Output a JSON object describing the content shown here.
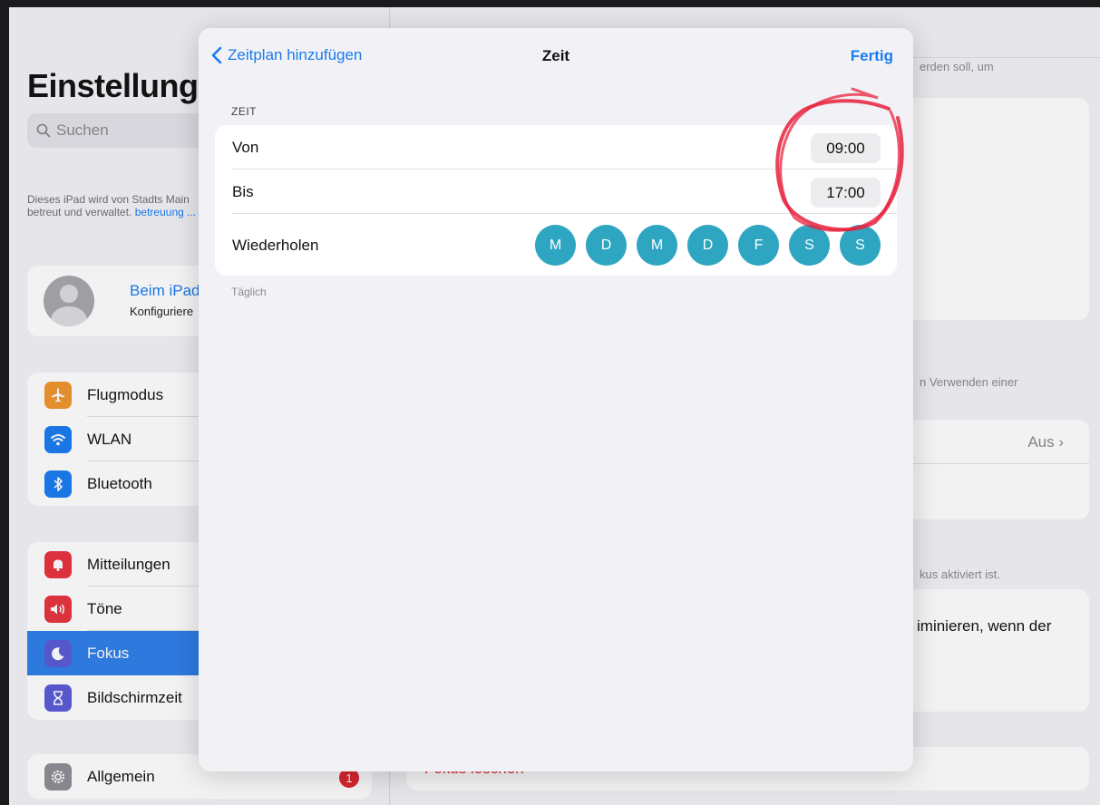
{
  "sidebar": {
    "title": "Einstellungen",
    "search_placeholder": "Suchen",
    "managed_text": "Dieses iPad wird von Stadts Main betreut und verwaltet.",
    "managed_link": "betreuung ...",
    "profile": {
      "title": "Beim iPad",
      "subtitle": "Konfiguriere"
    },
    "group1": [
      {
        "label": "Flugmodus",
        "icon": "airplane-icon",
        "color": "#f0952c"
      },
      {
        "label": "WLAN",
        "icon": "wifi-icon",
        "color": "#1a7cf0"
      },
      {
        "label": "Bluetooth",
        "icon": "bluetooth-icon",
        "color": "#1a7cf0"
      }
    ],
    "group2": [
      {
        "label": "Mitteilungen",
        "icon": "bell-icon",
        "color": "#e7343f"
      },
      {
        "label": "Töne",
        "icon": "speaker-icon",
        "color": "#e7343f"
      },
      {
        "label": "Fokus",
        "icon": "moon-icon",
        "color": "#5b5bd6",
        "active": true
      },
      {
        "label": "Bildschirmzeit",
        "icon": "hourglass-icon",
        "color": "#5b5bd6"
      }
    ],
    "group3": [
      {
        "label": "Allgemein",
        "icon": "gear-icon",
        "color": "#8e8e93",
        "badge": "1"
      }
    ]
  },
  "detail": {
    "text_top": "erden soll, um",
    "text_mid": "n Verwenden einer",
    "value_aus": "Aus",
    "text_lower": "kus aktiviert ist.",
    "body_text": "iminieren, wenn der",
    "delete_text": "Fokus löschen"
  },
  "modal": {
    "back_label": "Zeitplan hinzufügen",
    "title": "Zeit",
    "done_label": "Fertig",
    "section_header": "ZEIT",
    "from_label": "Von",
    "from_value": "09:00",
    "to_label": "Bis",
    "to_value": "17:00",
    "repeat_label": "Wiederholen",
    "days": [
      "M",
      "D",
      "M",
      "D",
      "F",
      "S",
      "S"
    ],
    "footer": "Täglich"
  },
  "colors": {
    "accent": "#1a7cf0",
    "day_circle": "#2fa6c1",
    "annotation": "#e8213e"
  }
}
